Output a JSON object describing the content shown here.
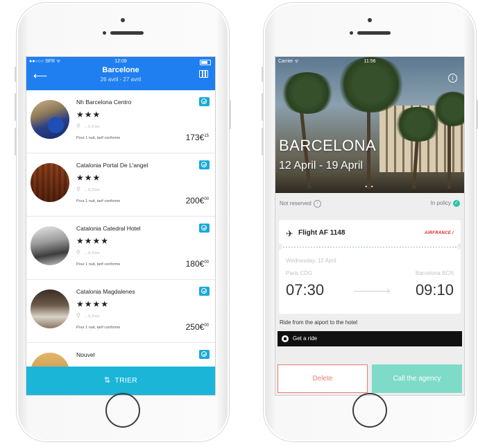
{
  "left_phone": {
    "status": {
      "carrier": "●●○○○ SFR ᯤ",
      "time": "12:09",
      "right": "↗ ✱"
    },
    "header": {
      "title": "Barcelone",
      "dates": "26 avril - 27 avril"
    },
    "hotels": [
      {
        "name": "Nh Barcelona Centro",
        "stars": "★★★",
        "distance": "... 0,3 km",
        "note": "Pour 1 nuit, tarif conforme",
        "price": "173€",
        "price_sup": "15"
      },
      {
        "name": "Catalonia Portal De L'angel",
        "stars": "★★★",
        "distance": "... 0,3 km",
        "note": "Pour 1 nuit, tarif conforme",
        "price": "200€",
        "price_sup": "00"
      },
      {
        "name": "Catalonia Catedral Hotel",
        "stars": "★★★★",
        "distance": "... 0,3 km",
        "note": "Pour 1 nuit, tarif conforme",
        "price": "180€",
        "price_sup": "00"
      },
      {
        "name": "Catalonia Magdalenes",
        "stars": "★★★★",
        "distance": "... 0,3 km",
        "note": "Pour 1 nuit, tarif conforme",
        "price": "250€",
        "price_sup": "00"
      },
      {
        "name": "Nouvel",
        "stars": "",
        "distance": "",
        "note": "",
        "price": "",
        "price_sup": ""
      }
    ],
    "sort_button": {
      "icon": "⇅",
      "label": "TRIER"
    }
  },
  "right_phone": {
    "status": {
      "carrier": "Carrier ᯤ",
      "time": "11:56"
    },
    "hero": {
      "city": "BARCELONA",
      "dates": "12 April - 19 April"
    },
    "reservation": {
      "status": "Not reserved",
      "policy": "In policy"
    },
    "flight": {
      "label": "Flight AF 1148",
      "airline": "AIRFRANCE",
      "date": "Wednesday, 12 April",
      "from": "Paris CDG",
      "to": "Barcelona BCN",
      "departure": "07:30",
      "arrival": "09:10"
    },
    "ride": {
      "label": "Ride from the aiport to the hotel",
      "button": "Get a ride"
    },
    "actions": {
      "delete": "Delete",
      "call": "Call the agency"
    }
  },
  "colors": {
    "header_blue": "#1f7ff0",
    "sort_bar": "#1bb5d8",
    "badge_blue": "#19a9d9",
    "policy_green": "#2fc4a5",
    "delete_red": "#ee7b70",
    "agency_green": "#7edbc7"
  }
}
